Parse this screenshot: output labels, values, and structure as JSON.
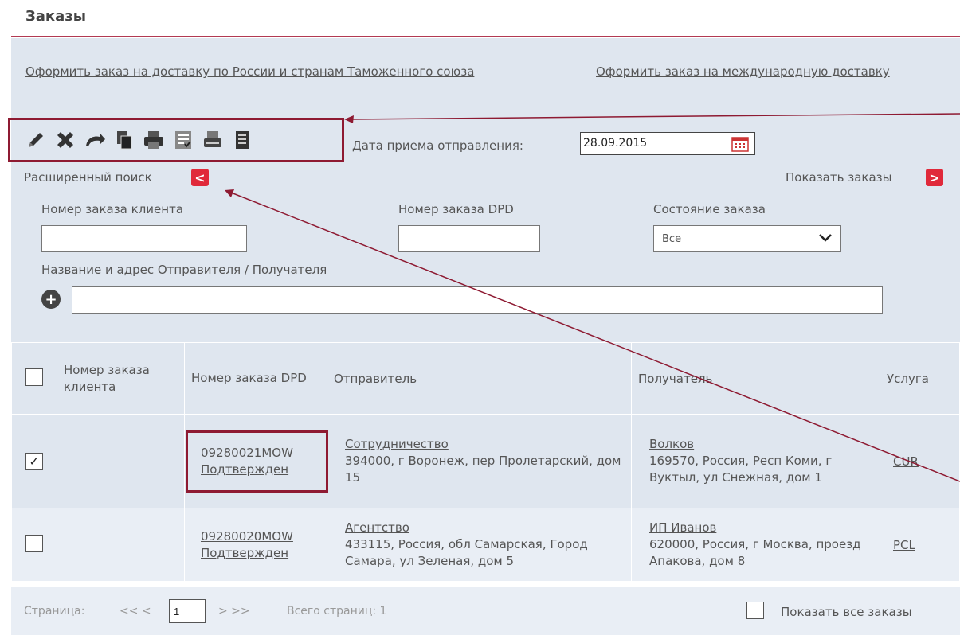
{
  "page": {
    "title": "Заказы"
  },
  "links": {
    "create_russia": "Оформить заказ на доставку по России и странам Таможенного союза",
    "create_international": "Оформить заказ на международную доставку"
  },
  "toolbar": {
    "icons": [
      "pencil-icon",
      "delete-x-icon",
      "undo-arrow-icon",
      "copy-icon",
      "print-icon",
      "checklist-icon",
      "printer-alt-icon",
      "document-print-icon"
    ]
  },
  "date": {
    "label": "Дата приема отправления:",
    "value": "28.09.2015"
  },
  "search": {
    "advanced_label": "Расширенный поиск",
    "advanced_toggle": "<",
    "show_orders_label": "Показать заказы",
    "show_orders_btn": ">",
    "client_number_label": "Номер заказа клиента",
    "client_number_value": "",
    "dpd_number_label": "Номер заказа DPD",
    "dpd_number_value": "",
    "status_label": "Состояние заказа",
    "status_value": "Все",
    "name_address_label": "Название и адрес Отправителя / Получателя",
    "name_address_value": "",
    "add_symbol": "+"
  },
  "table": {
    "columns": [
      "Номер заказа клиента",
      "Номер заказа DPD",
      "Отправитель",
      "Получатель",
      "Услуга"
    ],
    "rows": [
      {
        "checked": "✓",
        "client_number": "",
        "dpd_number": "09280021MOW",
        "status": "Подтвержден",
        "sender_name": "Сотрудничество",
        "sender_address": "394000, г Воронеж, пер Пролетарский, дом 15",
        "recipient_name": "Волков",
        "recipient_address": "169570, Россия, Респ Коми, г Вуктыл, ул Снежная, дом 1",
        "service": "CUR"
      },
      {
        "checked": "",
        "client_number": "",
        "dpd_number": "09280020MOW",
        "status": "Подтвержден",
        "sender_name": "Агентство",
        "sender_address": "433115, Россия, обл Самарская, Город Самара, ул Зеленая, дом 5",
        "recipient_name": "ИП Иванов",
        "recipient_address": "620000, Россия, г Москва, проезд Апакова, дом 8",
        "service": "PCL"
      }
    ]
  },
  "pagination": {
    "label": "Страница:",
    "prev": "<< <",
    "page": "1",
    "next": "> >>",
    "total": "Всего страниц: 1",
    "show_all_label": "Показать все заказы"
  },
  "colors": {
    "accent": "#8e1a32",
    "panel": "#dfe6ef",
    "button": "#e0293a"
  }
}
